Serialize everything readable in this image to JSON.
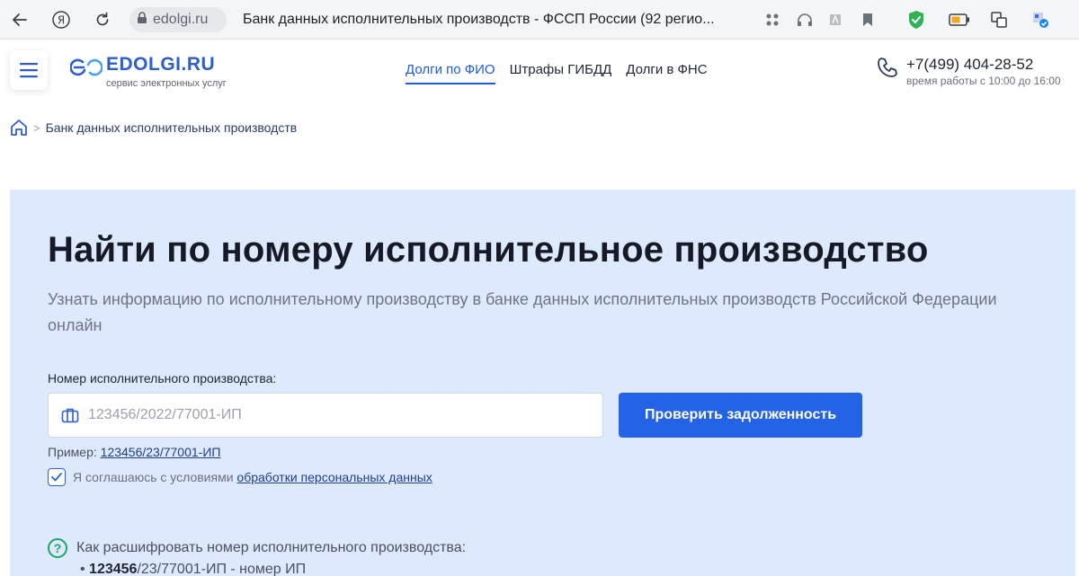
{
  "browser": {
    "url": "edolgi.ru",
    "tab_title": "Банк данных исполнительных производств - ФССП России (92 регио...",
    "accent": "#1fa36a"
  },
  "header": {
    "logo_name": "EDOLGI.RU",
    "logo_sub": "сервис электронных услуг",
    "nav": [
      {
        "label": "Долги по ФИО",
        "active": true
      },
      {
        "label": "Штрафы ГИБДД",
        "active": false
      },
      {
        "label": "Долги в ФНС",
        "active": false
      }
    ],
    "phone": "+7(499) 404-28-52",
    "hours": "время работы с 10:00 до 16:00"
  },
  "breadcrumb": {
    "current": "Банк данных исполнительных производств"
  },
  "hero": {
    "title": "Найти по номеру исполнительное производство",
    "subtitle": "Узнать информацию по исполнительному производству в банке данных исполнительных производств Российской Федерации онлайн",
    "field_label": "Номер исполнительного производства:",
    "input_placeholder": "123456/2022/77001-ИП",
    "input_value": "",
    "button_label": "Проверить задолженность",
    "example_prefix": "Пример:",
    "example_link": "123456/23/77001-ИП",
    "consent_prefix": "Я соглашаюсь с условиями",
    "consent_link": "обработки персональных данных",
    "consent_checked": true,
    "faq_question": "Как расшифровать номер исполнительного производства:",
    "faq_item_bold": "123456",
    "faq_item_rest": "/23/77001-ИП - номер ИП",
    "accent": "#2463e6",
    "background": "#dde9fd"
  }
}
